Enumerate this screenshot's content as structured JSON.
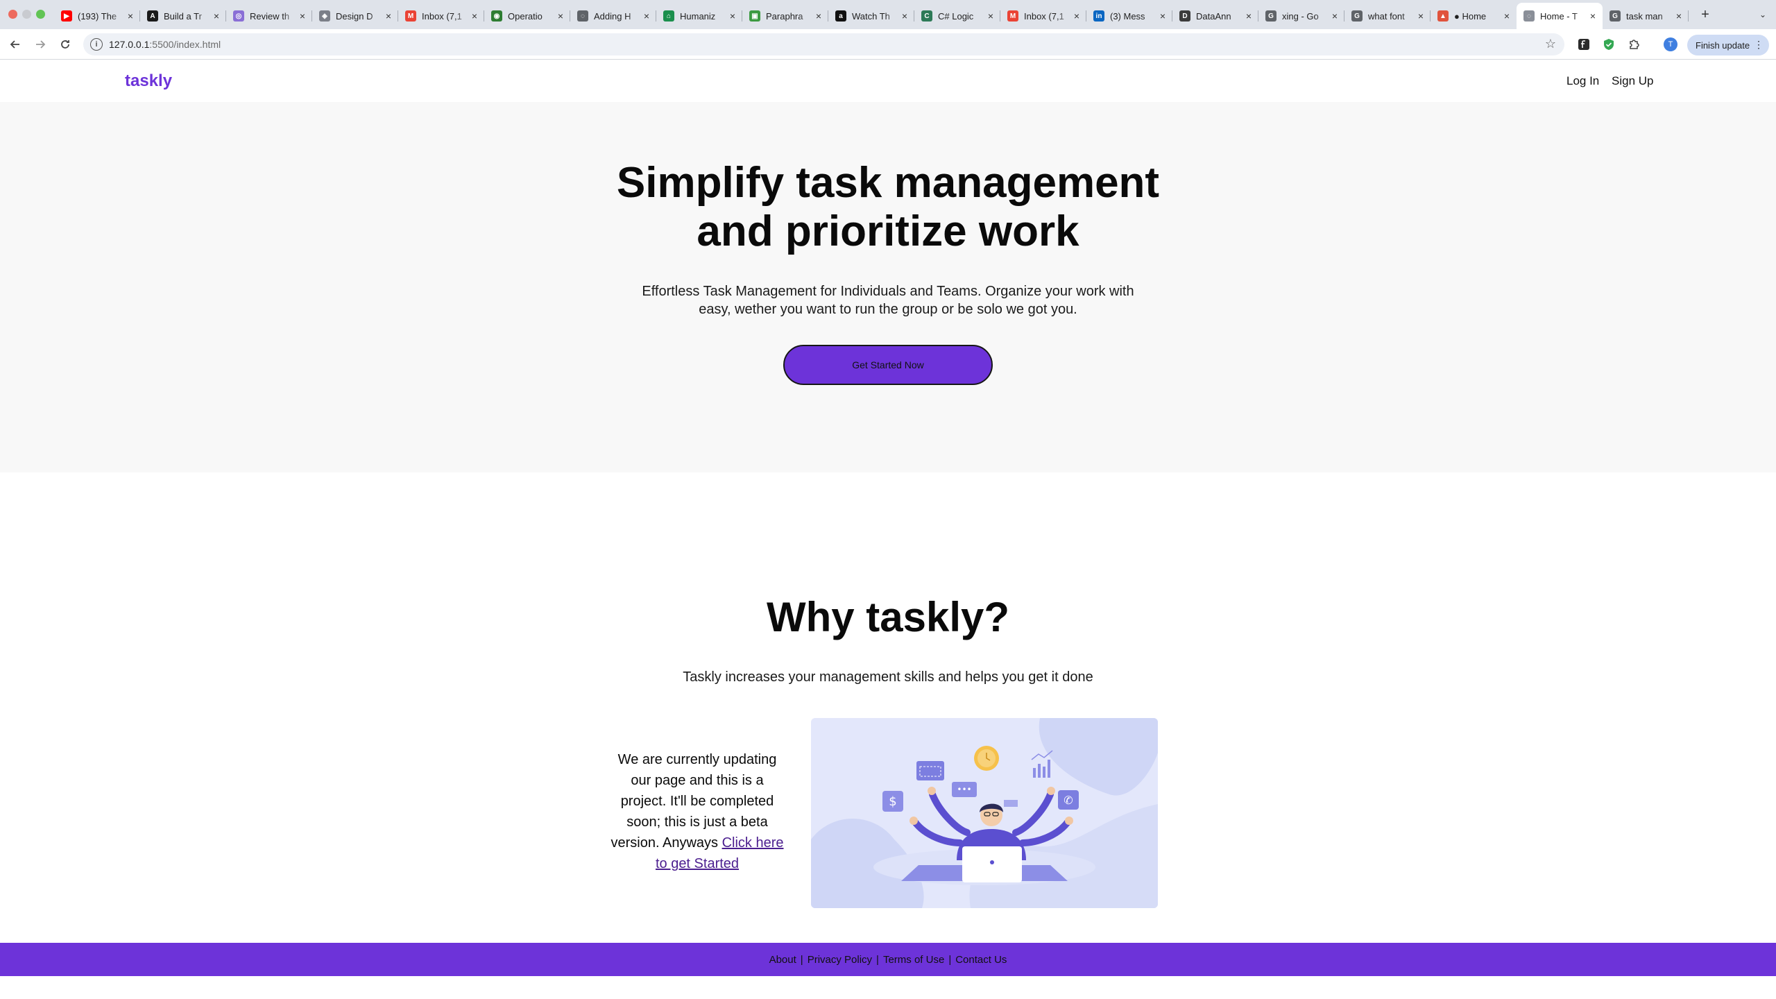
{
  "browser": {
    "tabs": [
      {
        "title": "(193) The",
        "favicon_color": "#ff0000",
        "favicon_glyph": "▶"
      },
      {
        "title": "Build a Tr",
        "favicon_color": "#1a1a1a",
        "favicon_glyph": "A"
      },
      {
        "title": "Review th",
        "favicon_color": "#8a6fd6",
        "favicon_glyph": "◎"
      },
      {
        "title": "Design D",
        "favicon_color": "#7b7f88",
        "favicon_glyph": "◈"
      },
      {
        "title": "Inbox (7,1",
        "favicon_color": "#ea4335",
        "favicon_glyph": "M"
      },
      {
        "title": "Operatio",
        "favicon_color": "#2e7d32",
        "favicon_glyph": "◉"
      },
      {
        "title": "Adding H",
        "favicon_color": "#5f6368",
        "favicon_glyph": "◌"
      },
      {
        "title": "Humaniz",
        "favicon_color": "#1b8f4d",
        "favicon_glyph": "⌂"
      },
      {
        "title": "Paraphra",
        "favicon_color": "#3c9a41",
        "favicon_glyph": "▣"
      },
      {
        "title": "Watch Th",
        "favicon_color": "#111111",
        "favicon_glyph": "a"
      },
      {
        "title": "C# Logic",
        "favicon_color": "#2d7a57",
        "favicon_glyph": "C"
      },
      {
        "title": "Inbox (7,1",
        "favicon_color": "#ea4335",
        "favicon_glyph": "M"
      },
      {
        "title": "(3) Mess",
        "favicon_color": "#0a66c2",
        "favicon_glyph": "in"
      },
      {
        "title": "DataAnn",
        "favicon_color": "#3b3b3b",
        "favicon_glyph": "D"
      },
      {
        "title": "xing - Go",
        "favicon_color": "#5f6368",
        "favicon_glyph": "G"
      },
      {
        "title": "what font",
        "favicon_color": "#5f6368",
        "favicon_glyph": "G"
      },
      {
        "title": "● Home",
        "favicon_color": "#e0533d",
        "favicon_glyph": "▲"
      },
      {
        "title": "Home - T",
        "favicon_color": "#8a8f98",
        "favicon_glyph": "◌",
        "active": true
      },
      {
        "title": "task man",
        "favicon_color": "#5f6368",
        "favicon_glyph": "G"
      }
    ],
    "new_tab": "+",
    "url_host": "127.0.0.1",
    "url_path": ":5500/index.html",
    "finish_update": "Finish update",
    "profile_initial": "T"
  },
  "site": {
    "logo": "taskly",
    "nav": {
      "login": "Log In",
      "signup": "Sign Up"
    },
    "hero": {
      "title_line1": "Simplify task management",
      "title_line2": "and prioritize work",
      "subtitle": "Effortless Task Management for Individuals and Teams. Organize your work with easy, wether you want to run the group or be solo we got you.",
      "cta": "Get Started Now"
    },
    "why": {
      "title": "Why taskly?",
      "subtitle": "Taskly increases your management skills and helps you get it done",
      "update_text": "We are currently updating our page and this is a project. It'll be completed soon; this is just a beta version. Anyways ",
      "update_link": "Click here to get Started"
    },
    "footer": {
      "links": [
        "About",
        "Privacy Policy",
        "Terms of Use",
        "Contact Us"
      ],
      "separator": "|"
    }
  },
  "colors": {
    "brand": "#6d33d9",
    "hero_bg": "#f8f8f8",
    "illustration_bg": "#e3e7fb"
  }
}
